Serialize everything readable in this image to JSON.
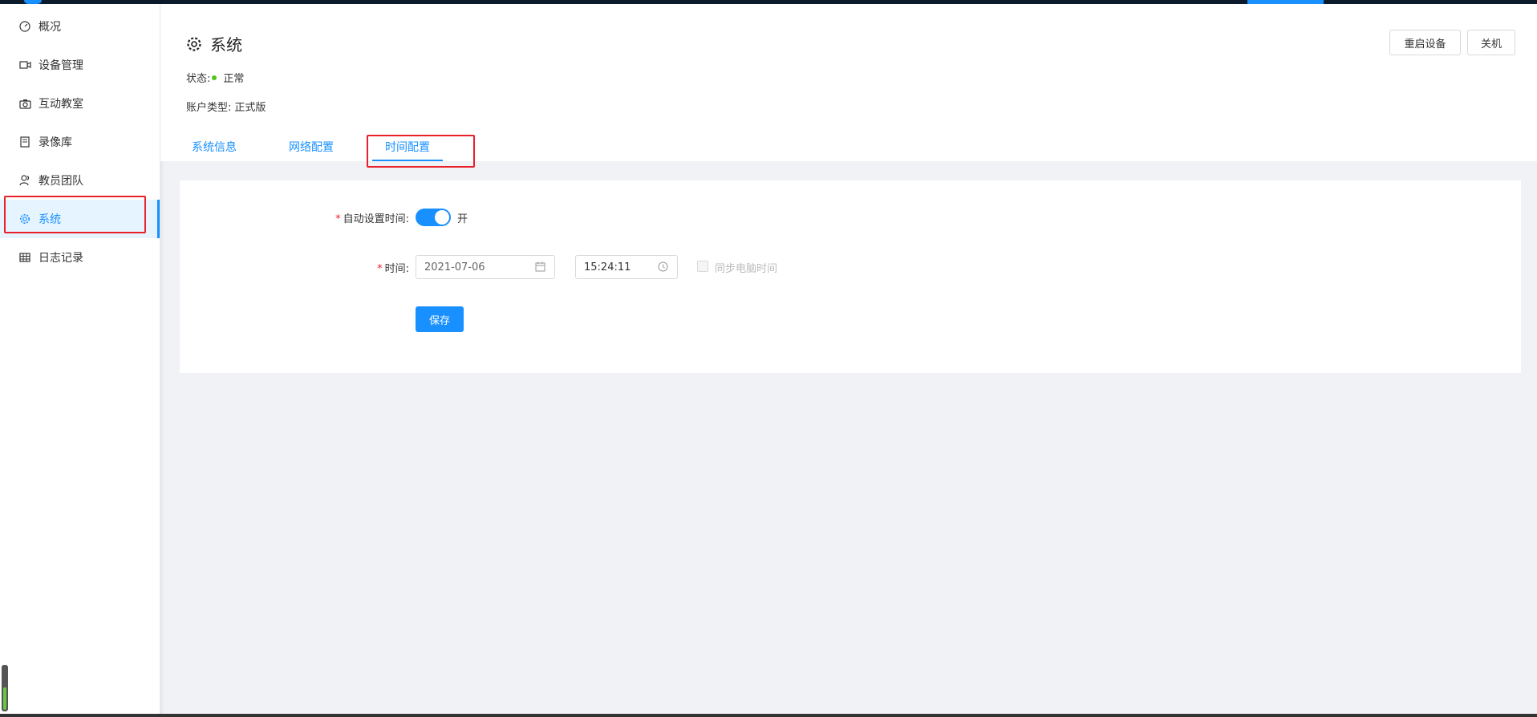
{
  "sidebar": {
    "items": [
      {
        "label": "概况",
        "icon": "dashboard-icon"
      },
      {
        "label": "设备管理",
        "icon": "video-camera-icon"
      },
      {
        "label": "互动教室",
        "icon": "camera-icon"
      },
      {
        "label": "录像库",
        "icon": "book-icon"
      },
      {
        "label": "教员团队",
        "icon": "team-icon"
      },
      {
        "label": "系统",
        "icon": "gear-icon",
        "active": true
      },
      {
        "label": "日志记录",
        "icon": "table-icon"
      }
    ]
  },
  "header": {
    "title": "系统",
    "status_label": "状态:",
    "status_value": "正常",
    "account_label": "账户类型:",
    "account_value": "正式版",
    "restart_label": "重启设备",
    "shutdown_label": "关机"
  },
  "tabs": [
    {
      "label": "系统信息"
    },
    {
      "label": "网络配置"
    },
    {
      "label": "时间配置",
      "active": true
    }
  ],
  "form": {
    "auto_time_label": "自动设置时间:",
    "auto_time_state": "开",
    "time_label": "时间:",
    "date_value": "2021-07-06",
    "time_value": "15:24:11",
    "sync_label": "同步电脑时间",
    "save_label": "保存"
  },
  "colors": {
    "accent": "#1890ff",
    "status_ok": "#52c41a",
    "highlight_box": "#e8202a"
  }
}
